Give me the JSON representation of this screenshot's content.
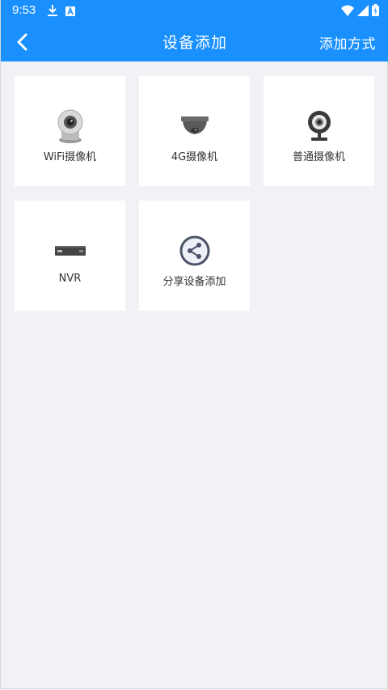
{
  "status_bar": {
    "time": "9:53"
  },
  "header": {
    "title": "设备添加",
    "action": "添加方式"
  },
  "device_types": [
    {
      "label": "WiFi摄像机",
      "icon": "wifi-camera-icon"
    },
    {
      "label": "4G摄像机",
      "icon": "dome-camera-icon"
    },
    {
      "label": "普通摄像机",
      "icon": "webcam-icon"
    },
    {
      "label": "NVR",
      "icon": "nvr-icon"
    },
    {
      "label": "分享设备添加",
      "icon": "share-icon"
    }
  ],
  "colors": {
    "accent": "#1a90ff",
    "background": "#f0f2f5",
    "card": "#ffffff"
  }
}
